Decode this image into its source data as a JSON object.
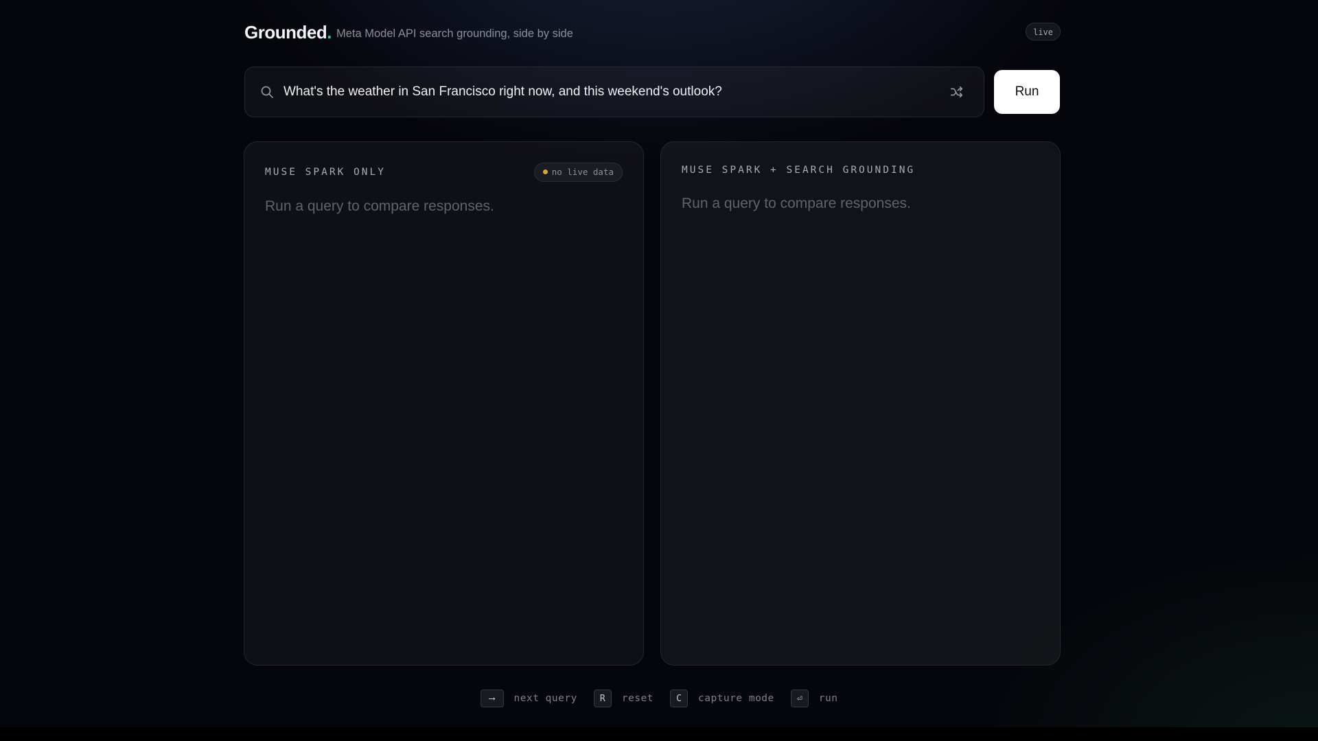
{
  "header": {
    "brand": "Grounded",
    "brand_dot": ".",
    "tagline": "Meta Model API search grounding, side by side",
    "status_badge": "live"
  },
  "search": {
    "query": "What's the weather in San Francisco right now, and this weekend's outlook?",
    "run_label": "Run"
  },
  "panels": {
    "left": {
      "title": "MUSE SPARK ONLY",
      "badge": "no live data",
      "placeholder": "Run a query to compare responses."
    },
    "right": {
      "title": "MUSE SPARK + SEARCH GROUNDING",
      "placeholder": "Run a query to compare responses."
    }
  },
  "shortcuts": [
    {
      "key": "⟶",
      "label": "next query"
    },
    {
      "key": "R",
      "label": "reset"
    },
    {
      "key": "C",
      "label": "capture mode"
    },
    {
      "key": "⏎",
      "label": "run"
    }
  ],
  "colors": {
    "accent_green": "#2fd08c",
    "warning_amber": "#d9a33a",
    "background": "#05060b"
  },
  "icons": {
    "search": "search-icon",
    "shuffle": "shuffle-icon"
  }
}
